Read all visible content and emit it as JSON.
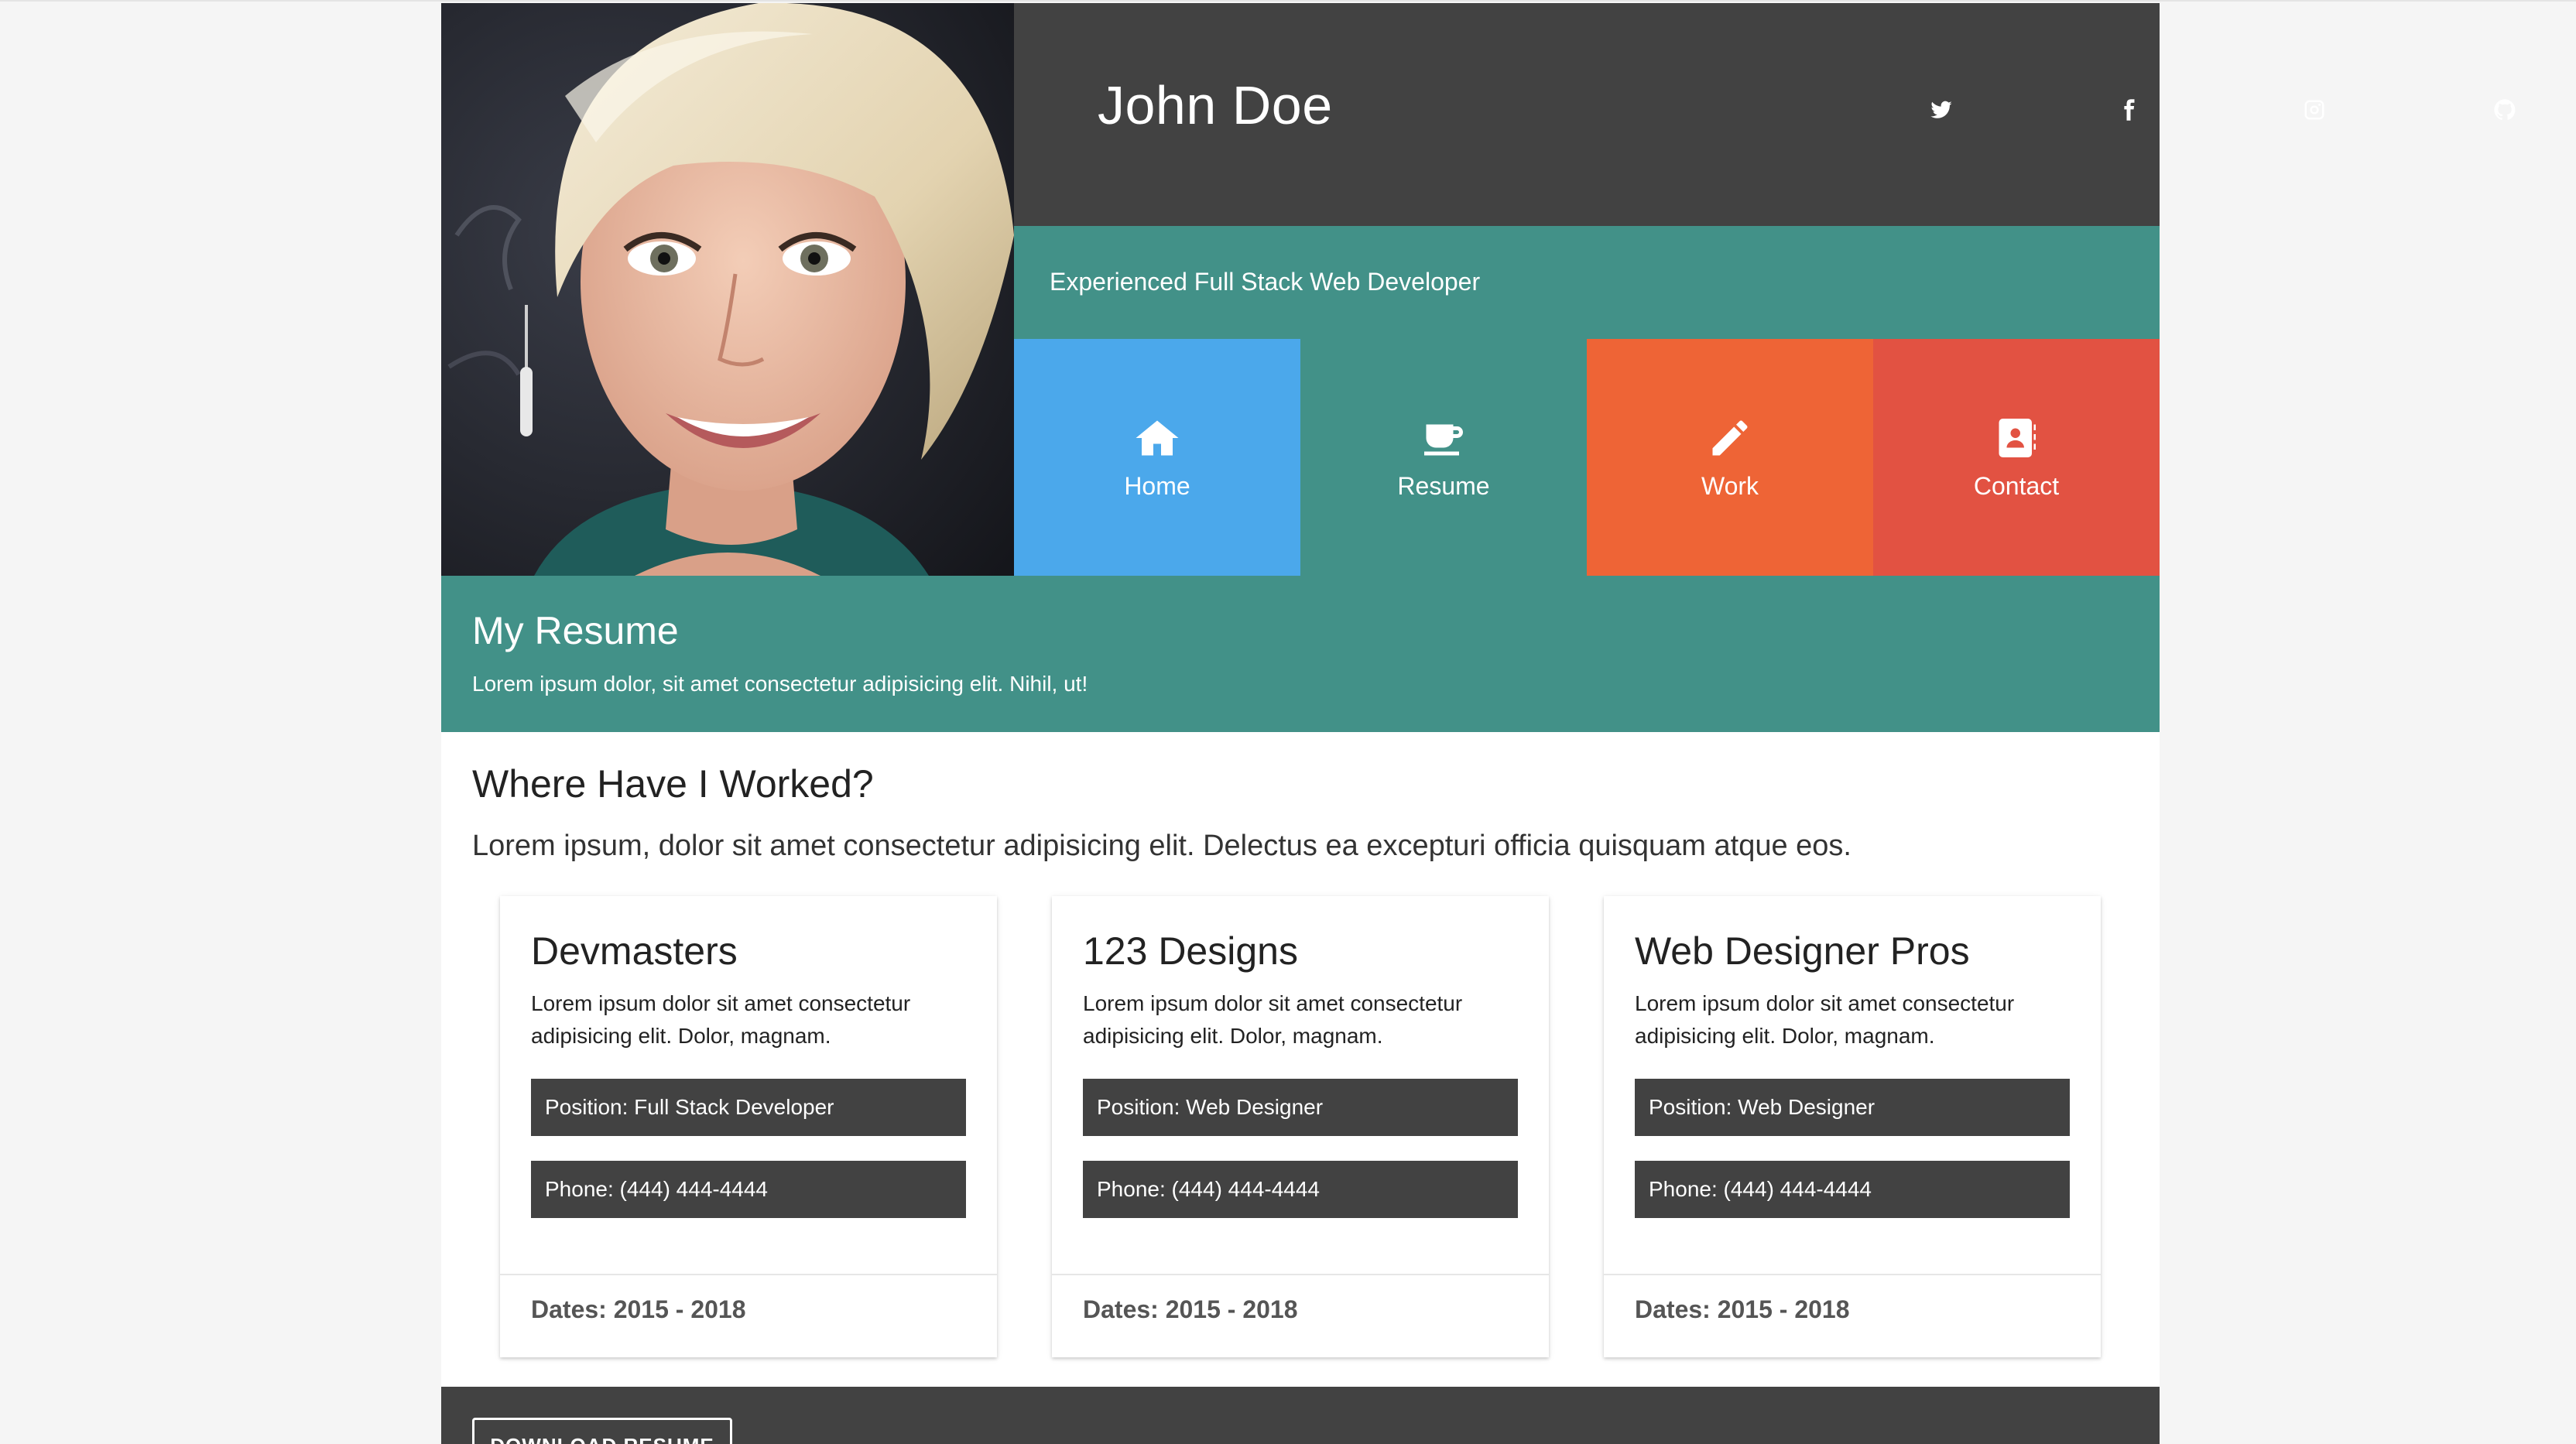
{
  "header": {
    "name": "John Doe",
    "tagline": "Experienced Full Stack Web Developer",
    "social": [
      {
        "icon": "twitter-icon"
      },
      {
        "icon": "facebook-icon"
      },
      {
        "icon": "instagram-icon"
      },
      {
        "icon": "github-icon"
      }
    ]
  },
  "nav": {
    "items": [
      {
        "label": "Home",
        "icon": "home-icon",
        "color": "#4BA8EB"
      },
      {
        "label": "Resume",
        "icon": "coffee-cup-icon",
        "color": "#429188"
      },
      {
        "label": "Work",
        "icon": "pencil-icon",
        "color": "#EE6436"
      },
      {
        "label": "Contact",
        "icon": "address-book-icon",
        "color": "#E25242"
      }
    ]
  },
  "banner": {
    "title": "My Resume",
    "subtitle": "Lorem ipsum dolor, sit amet consectetur adipisicing elit. Nihil, ut!"
  },
  "work": {
    "title": "Where Have I Worked?",
    "lead": "Lorem ipsum, dolor sit amet consectetur adipisicing elit. Delectus ea excepturi officia quisquam atque eos.",
    "cards": [
      {
        "company": "Devmasters",
        "description": "Lorem ipsum dolor sit amet consectetur adipisicing elit. Dolor, magnam.",
        "position": "Position: Full Stack Developer",
        "phone": "Phone: (444) 444-4444",
        "dates": "Dates: 2015 - 2018"
      },
      {
        "company": "123 Designs",
        "description": "Lorem ipsum dolor sit amet consectetur adipisicing elit. Dolor, magnam.",
        "position": "Position: Web Designer",
        "phone": "Phone: (444) 444-4444",
        "dates": "Dates: 2015 - 2018"
      },
      {
        "company": "Web Designer Pros",
        "description": "Lorem ipsum dolor sit amet consectetur adipisicing elit. Dolor, magnam.",
        "position": "Position: Web Designer",
        "phone": "Phone: (444) 444-4444",
        "dates": "Dates: 2015 - 2018"
      }
    ]
  },
  "footer": {
    "download_label": "DOWNLOAD RESUME"
  }
}
